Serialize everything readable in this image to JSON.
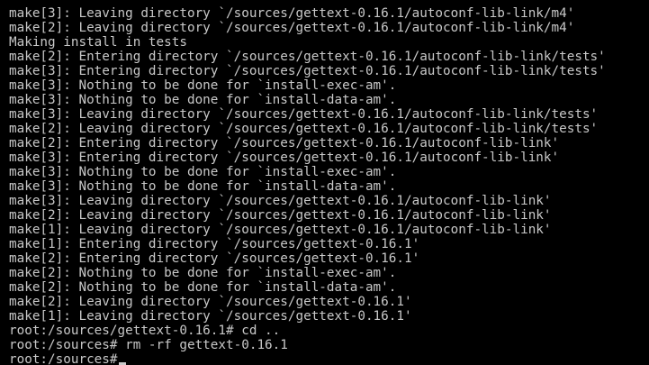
{
  "terminal": {
    "lines": [
      "make[3]: Leaving directory `/sources/gettext-0.16.1/autoconf-lib-link/m4'",
      "make[2]: Leaving directory `/sources/gettext-0.16.1/autoconf-lib-link/m4'",
      "Making install in tests",
      "make[2]: Entering directory `/sources/gettext-0.16.1/autoconf-lib-link/tests'",
      "make[3]: Entering directory `/sources/gettext-0.16.1/autoconf-lib-link/tests'",
      "make[3]: Nothing to be done for `install-exec-am'.",
      "make[3]: Nothing to be done for `install-data-am'.",
      "make[3]: Leaving directory `/sources/gettext-0.16.1/autoconf-lib-link/tests'",
      "make[2]: Leaving directory `/sources/gettext-0.16.1/autoconf-lib-link/tests'",
      "make[2]: Entering directory `/sources/gettext-0.16.1/autoconf-lib-link'",
      "make[3]: Entering directory `/sources/gettext-0.16.1/autoconf-lib-link'",
      "make[3]: Nothing to be done for `install-exec-am'.",
      "make[3]: Nothing to be done for `install-data-am'.",
      "make[3]: Leaving directory `/sources/gettext-0.16.1/autoconf-lib-link'",
      "make[2]: Leaving directory `/sources/gettext-0.16.1/autoconf-lib-link'",
      "make[1]: Leaving directory `/sources/gettext-0.16.1/autoconf-lib-link'",
      "make[1]: Entering directory `/sources/gettext-0.16.1'",
      "make[2]: Entering directory `/sources/gettext-0.16.1'",
      "make[2]: Nothing to be done for `install-exec-am'.",
      "make[2]: Nothing to be done for `install-data-am'.",
      "make[2]: Leaving directory `/sources/gettext-0.16.1'",
      "make[1]: Leaving directory `/sources/gettext-0.16.1'",
      "root:/sources/gettext-0.16.1# cd ..",
      "root:/sources# rm -rf gettext-0.16.1"
    ],
    "prompt": "root:/sources#",
    "colors": {
      "background": "#000000",
      "foreground": "#c8c8c8"
    }
  }
}
